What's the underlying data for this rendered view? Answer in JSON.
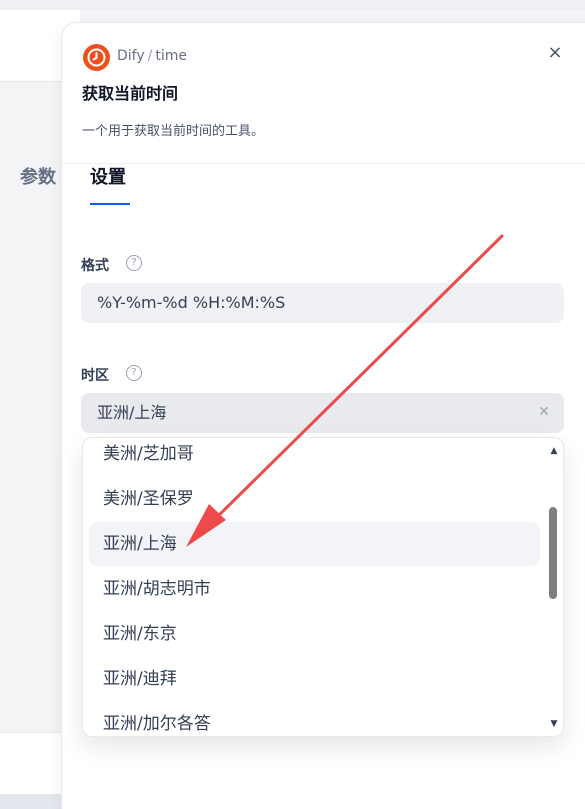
{
  "header": {
    "provider": "Dify",
    "separator": "/",
    "tool_id": "time",
    "title": "获取当前时间",
    "description": "一个用于获取当前时间的工具。",
    "close_glyph": "×"
  },
  "tabs": [
    {
      "label": "参数"
    },
    {
      "label": "设置"
    }
  ],
  "form": {
    "format": {
      "label": "格式",
      "help_glyph": "?",
      "value": "%Y-%m-%d %H:%M:%S"
    },
    "timezone": {
      "label": "时区",
      "help_glyph": "?",
      "value": "亚洲/上海",
      "clear_glyph": "✕"
    }
  },
  "dropdown": {
    "options": [
      {
        "label": "美洲/芝加哥"
      },
      {
        "label": "美洲/圣保罗"
      },
      {
        "label": "亚洲/上海"
      },
      {
        "label": "亚洲/胡志明市"
      },
      {
        "label": "亚洲/东京"
      },
      {
        "label": "亚洲/迪拜"
      },
      {
        "label": "亚洲/加尔各答"
      }
    ],
    "selected_index": 2,
    "scroll_up_glyph": "▲",
    "scroll_down_glyph": "▼"
  },
  "colors": {
    "accent": "#155eef",
    "logo": "#ef4f1b",
    "annotation_arrow": "#ef4a4a"
  },
  "icons": {
    "logo": "clock-icon",
    "close": "close-icon",
    "help": "question-circle-icon",
    "clear": "clear-icon"
  }
}
